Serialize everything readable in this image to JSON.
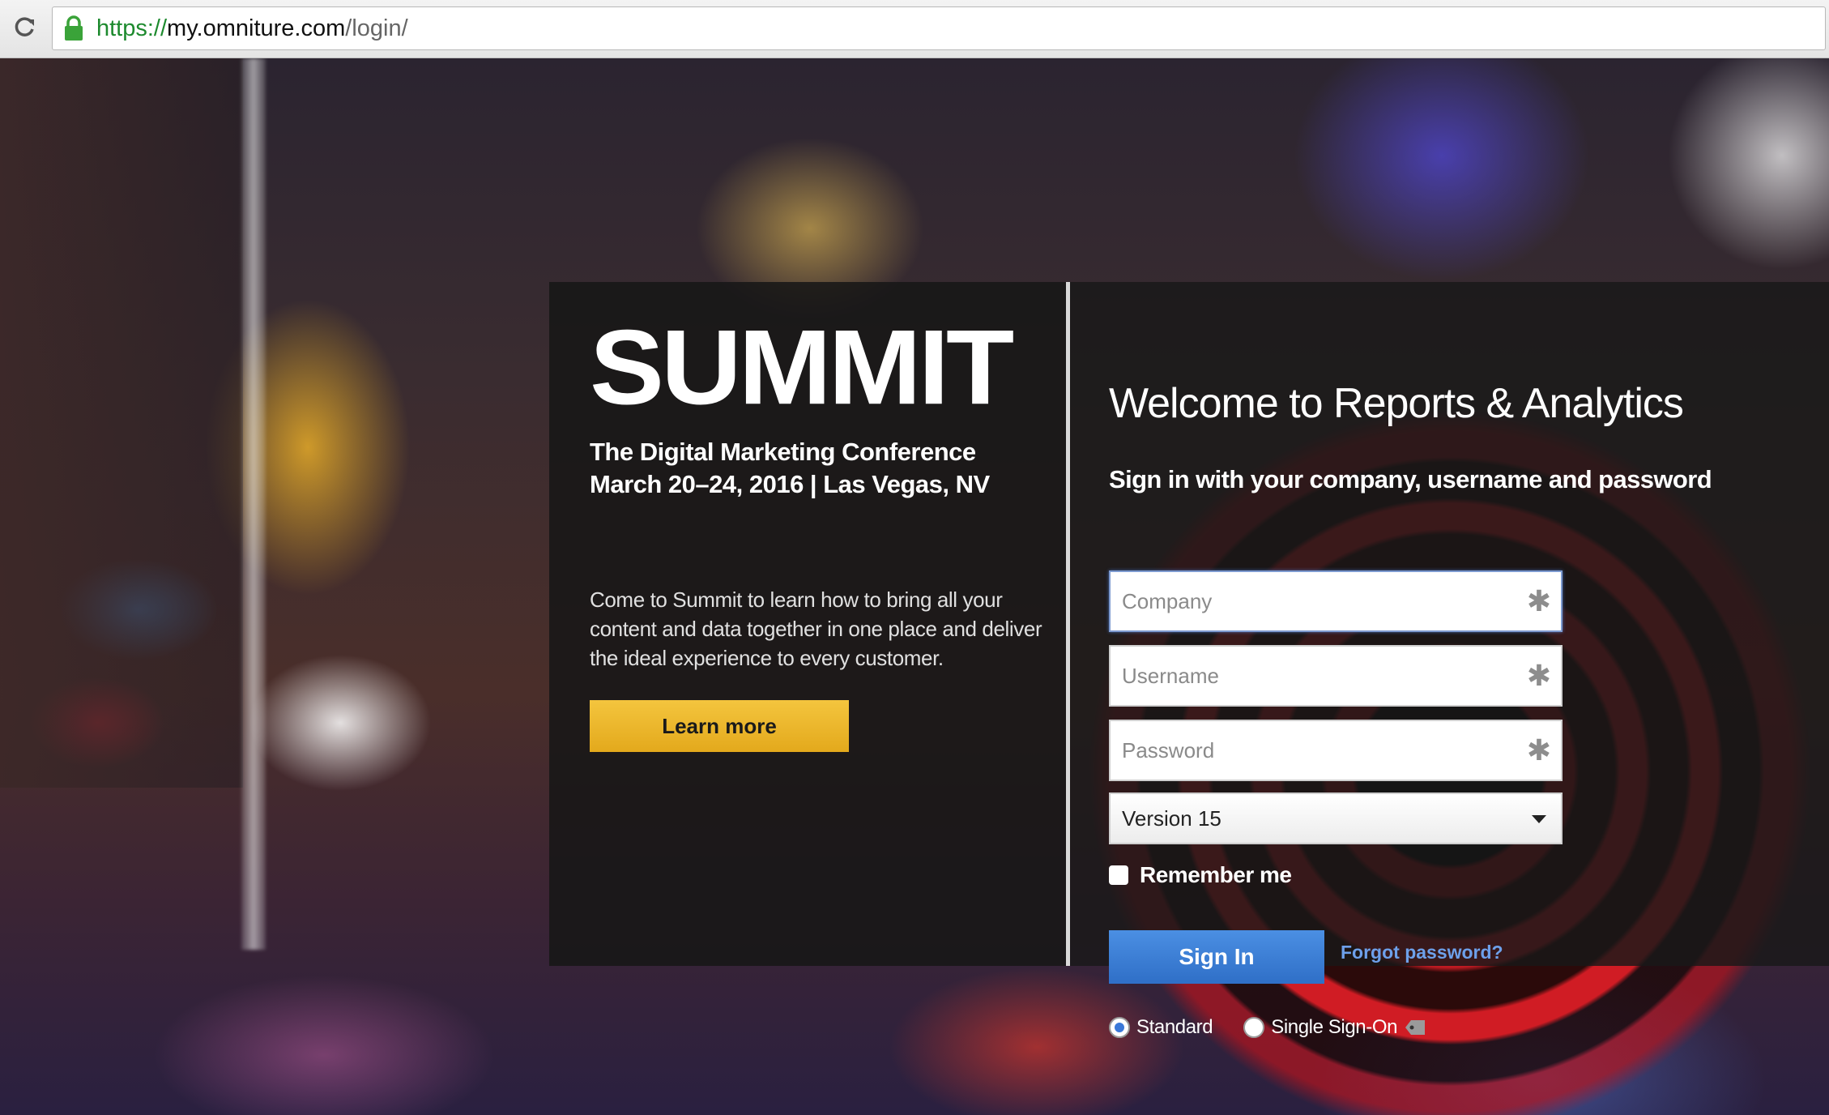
{
  "browser": {
    "url_scheme": "https://",
    "url_host": "my.omniture.com",
    "url_path": "/login/",
    "reload_icon": "reload-icon",
    "lock_icon": "lock-icon"
  },
  "promo": {
    "logo_text": "SUMMIT",
    "conference_line1": "The Digital Marketing Conference",
    "conference_line2": "March 20–24, 2016 | Las Vegas, NV",
    "description": "Come to Summit to learn how to bring all your content and data together in one place and deliver the ideal experience to every customer.",
    "cta_label": "Learn more",
    "cta_color": "#f0b92f"
  },
  "login": {
    "title": "Welcome to Reports & Analytics",
    "instructions": "Sign in with your company, username and password",
    "company_placeholder": "Company",
    "username_placeholder": "Username",
    "password_placeholder": "Password",
    "required_marker": "✱",
    "version_selected": "Version 15",
    "remember_label": "Remember me",
    "signin_label": "Sign In",
    "forgot_label": "Forgot password?",
    "auth_options": [
      "Standard",
      "Single Sign-On"
    ],
    "auth_selected": "Standard",
    "accent_color": "#3a78d8"
  }
}
